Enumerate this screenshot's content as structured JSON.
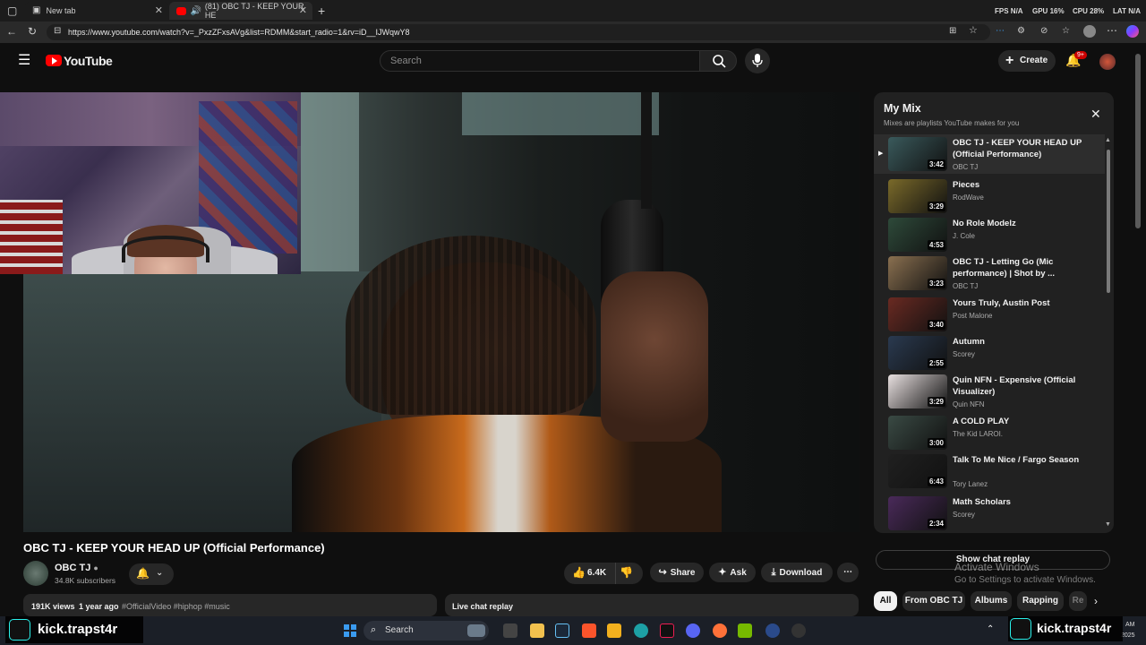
{
  "browser": {
    "tabs": [
      {
        "label": "New tab",
        "active": false
      },
      {
        "label": "(81) OBC TJ - KEEP YOUR HE",
        "active": true
      }
    ],
    "url": "https://www.youtube.com/watch?v=_PxzZFxsAVg&list=RDMM&start_radio=1&rv=iD__IJWqwY8",
    "stats": {
      "fps_label": "FPS",
      "fps_value": "N/A",
      "gpu_label": "GPU",
      "gpu_value": "16%",
      "cpu_label": "CPU",
      "cpu_value": "28%",
      "lat_label": "LAT",
      "lat_value": "N/A"
    }
  },
  "header": {
    "logo": "YouTube",
    "search_placeholder": "Search",
    "create_label": "Create",
    "notif_count": "9+"
  },
  "video": {
    "title": "OBC TJ - KEEP YOUR HEAD UP (Official Performance)",
    "channel": "OBC TJ",
    "subscribers": "34.8K subscribers",
    "likes": "6.4K",
    "share_label": "Share",
    "ask_label": "Ask",
    "download_label": "Download",
    "views": "191K views",
    "age": "1 year ago",
    "hashtags": "#OfficialVideo #hiphop #music",
    "live_chat_label": "Live chat replay"
  },
  "mix": {
    "title": "My Mix",
    "subtitle": "Mixes are playlists YouTube makes for you",
    "items": [
      {
        "title": "OBC TJ - KEEP YOUR HEAD UP (Official Performance)",
        "channel": "OBC TJ",
        "duration": "3:42",
        "playing": true,
        "color": "#3a5a5c"
      },
      {
        "title": "Pieces",
        "channel": "RodWave",
        "duration": "3:29",
        "playing": false,
        "color": "#7a6a2a"
      },
      {
        "title": "No Role Modelz",
        "channel": "J. Cole",
        "duration": "4:53",
        "playing": false,
        "color": "#2e4a3a"
      },
      {
        "title": "OBC TJ - Letting Go (Mic performance) | Shot by ...",
        "channel": "OBC TJ",
        "duration": "3:23",
        "playing": false,
        "color": "#8a7050"
      },
      {
        "title": "Yours Truly, Austin Post",
        "channel": "Post Malone",
        "duration": "3:40",
        "playing": false,
        "color": "#6a2a22"
      },
      {
        "title": "Autumn",
        "channel": "Scorey",
        "duration": "2:55",
        "playing": false,
        "color": "#2a3a50"
      },
      {
        "title": "Quin NFN - Expensive (Official Visualizer)",
        "channel": "Quin NFN",
        "duration": "3:29",
        "playing": false,
        "color": "#e8e0e0"
      },
      {
        "title": "A COLD PLAY",
        "channel": "The Kid LAROI.",
        "duration": "3:00",
        "playing": false,
        "color": "#3a4a44"
      },
      {
        "title": "Talk To Me Nice / Fargo Season",
        "channel": "Tory Lanez",
        "duration": "6:43",
        "playing": false,
        "color": "#202020"
      },
      {
        "title": "Math Scholars",
        "channel": "Scorey",
        "duration": "2:34",
        "playing": false,
        "color": "#4a2a5a"
      }
    ],
    "show_chat_label": "Show chat replay"
  },
  "filters": [
    "All",
    "From OBC TJ",
    "Albums",
    "Rapping",
    "Re"
  ],
  "watermark": {
    "line1": "Activate Windows",
    "line2": "Go to Settings to activate Windows."
  },
  "overlay": {
    "kick_left": "kick.trapst4r",
    "kick_right": "kick.trapst4r"
  },
  "taskbar": {
    "search_placeholder": "Search",
    "time": "AM",
    "date": "2025"
  }
}
